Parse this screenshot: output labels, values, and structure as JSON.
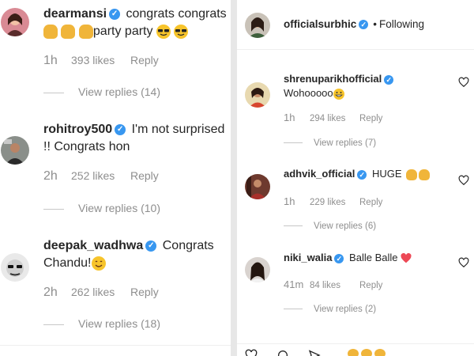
{
  "left_panel": {
    "comments": [
      {
        "username": "dearmansi",
        "text_a": "congrats congrats",
        "text_b": "party party",
        "time": "1h",
        "likes": "393 likes",
        "reply": "Reply",
        "view_replies": "View replies (14)"
      },
      {
        "username": "rohitroy500",
        "text_a": "I'm not surprised",
        "text_b": "!! Congrats hon",
        "time": "2h",
        "likes": "252 likes",
        "reply": "Reply",
        "view_replies": "View replies (10)"
      },
      {
        "username": "deepak_wadhwa",
        "text_a": "Congrats",
        "text_b": "Chandu!",
        "time": "2h",
        "likes": "262 likes",
        "reply": "Reply",
        "view_replies": "View replies (18)"
      }
    ]
  },
  "right_panel": {
    "header": {
      "username": "officialsurbhic",
      "dot": "•",
      "following": "Following"
    },
    "comments": [
      {
        "username": "shrenuparikhofficial",
        "text": "Wohooooo",
        "time": "1h",
        "likes": "294 likes",
        "reply": "Reply",
        "view_replies": "View replies (7)"
      },
      {
        "username": "adhvik_official",
        "text": "HUGE",
        "time": "1h",
        "likes": "229 likes",
        "reply": "Reply",
        "view_replies": "View replies (6)"
      },
      {
        "username": "niki_walia",
        "text": "Balle Balle",
        "time": "41m",
        "likes": "84 likes",
        "reply": "Reply",
        "view_replies": "View replies (2)"
      }
    ]
  },
  "colors": {
    "verified": "#3897f0",
    "muted": "#8e8e8e",
    "text": "#262626",
    "heart": "#ed4956",
    "emoji": "#f7c42b"
  },
  "icons": [
    "verified-badge-icon",
    "heart-outline-icon",
    "heart-red-icon",
    "clapping-hands-icon",
    "sunglasses-emoji-icon",
    "raised-hands-emoji-icon",
    "grinning-emoji-icon",
    "smiling-emoji-icon",
    "comment-icon",
    "share-icon"
  ]
}
